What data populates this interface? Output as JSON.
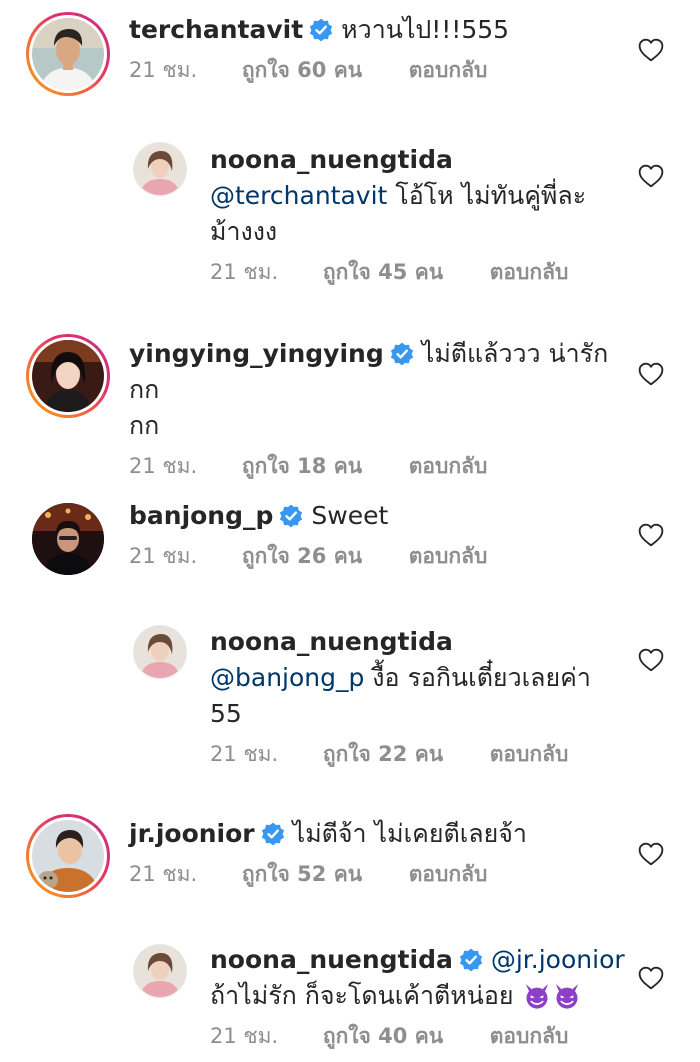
{
  "colors": {
    "text": "#262626",
    "meta": "#8e8e8e",
    "mention": "#00376b",
    "verified": "#3897f0",
    "story_ring": [
      "#f9a51a",
      "#e1306c",
      "#c13584"
    ]
  },
  "icons": {
    "verified": "verified-badge-icon",
    "like": "heart-outline-icon",
    "emoji": "smiling-devil-emoji"
  },
  "comments": [
    {
      "username": "terchantavit",
      "verified": true,
      "text": "หวานไป!!!555",
      "time": "21 ชม.",
      "likes": "ถูกใจ 60 คน",
      "reply": "ตอบกลับ"
    },
    {
      "username": "noona_nuengtida",
      "verified": false,
      "mention": "@terchantavit",
      "text_after_mention": " โอ้โห ไม่ทันคู่พี่ละ",
      "text_line2": "ม้างงง",
      "time": "21 ชม.",
      "likes": "ถูกใจ 45 คน",
      "reply": "ตอบกลับ"
    },
    {
      "username": "yingying_yingying",
      "verified": true,
      "text": "ไม่ตีแล้ววว น่ารักกก",
      "text_line2": "กก",
      "time": "21 ชม.",
      "likes": "ถูกใจ 18 คน",
      "reply": "ตอบกลับ"
    },
    {
      "username": "banjong_p",
      "verified": true,
      "text": "Sweet",
      "time": "21 ชม.",
      "likes": "ถูกใจ 26 คน",
      "reply": "ตอบกลับ"
    },
    {
      "username": "noona_nuengtida",
      "verified": false,
      "mention": "@banjong_p",
      "text_after_mention": " งื้อ รอกินเตี๋ยวเลยค่า",
      "text_line2": "55",
      "time": "21 ชม.",
      "likes": "ถูกใจ 22 คน",
      "reply": "ตอบกลับ"
    },
    {
      "username": "jr.joonior",
      "verified": true,
      "text": "ไม่ตีจ้า ไม่เคยตีเลยจ้า",
      "time": "21 ชม.",
      "likes": "ถูกใจ 52 คน",
      "reply": "ตอบกลับ"
    },
    {
      "username": "noona_nuengtida",
      "verified": true,
      "mention": "@jr.joonior",
      "text_line2": "ถ้าไม่รัก ก็จะโดนเค้าตีหน่อย",
      "time": "21 ชม.",
      "likes": "ถูกใจ 40 คน",
      "reply": "ตอบกลับ"
    }
  ]
}
